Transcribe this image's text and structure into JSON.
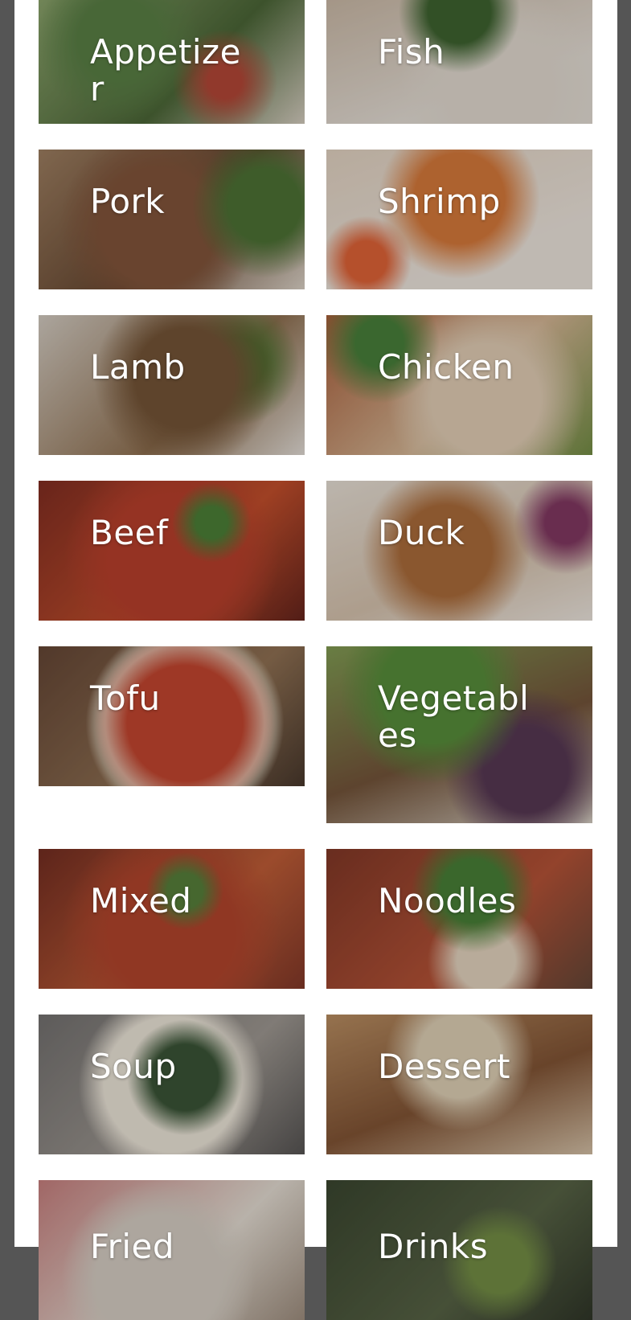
{
  "menu": {
    "categories": [
      {
        "id": "appetizer",
        "label": "Appetizer"
      },
      {
        "id": "fish",
        "label": "Fish"
      },
      {
        "id": "pork",
        "label": "Pork"
      },
      {
        "id": "shrimp",
        "label": "Shrimp"
      },
      {
        "id": "lamb",
        "label": "Lamb"
      },
      {
        "id": "chicken",
        "label": "Chicken"
      },
      {
        "id": "beef",
        "label": "Beef"
      },
      {
        "id": "duck",
        "label": "Duck"
      },
      {
        "id": "tofu",
        "label": "Tofu"
      },
      {
        "id": "vegetables",
        "label": "Vegetables"
      },
      {
        "id": "mixed",
        "label": "Mixed"
      },
      {
        "id": "noodles",
        "label": "Noodles"
      },
      {
        "id": "soup",
        "label": "Soup"
      },
      {
        "id": "dessert",
        "label": "Dessert"
      },
      {
        "id": "fried",
        "label": "Fried"
      },
      {
        "id": "drinks",
        "label": "Drinks"
      }
    ]
  },
  "colors": {
    "backdrop": "#555555",
    "page": "#ffffff",
    "label": "#ffffff"
  }
}
